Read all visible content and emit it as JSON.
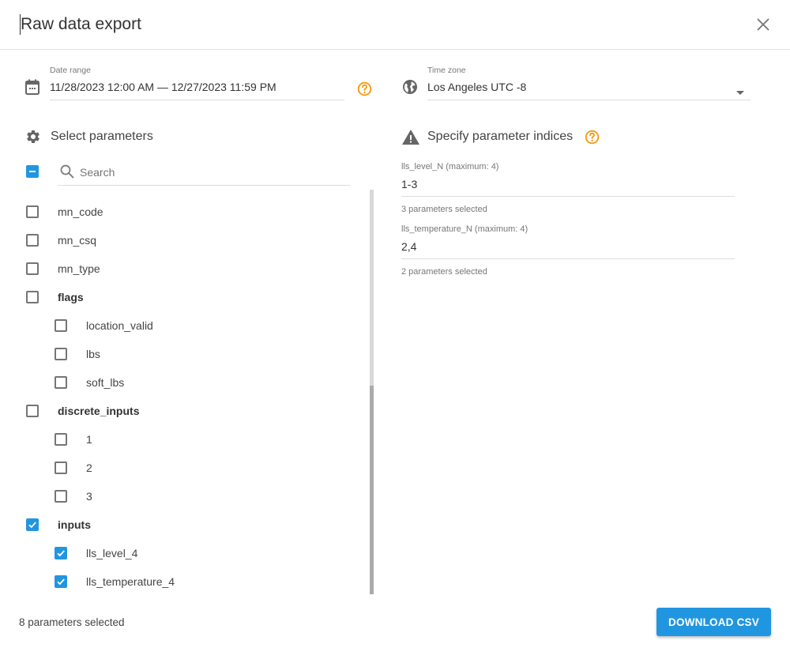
{
  "dialog": {
    "title": "Raw data export",
    "close_icon": "close-icon"
  },
  "date_range": {
    "label": "Date range",
    "value": "11/28/2023 12:00 AM — 12/27/2023 11:59 PM",
    "icon": "calendar-icon",
    "help_icon": "help-circle-icon"
  },
  "time_zone": {
    "label": "Time zone",
    "value": "Los Angeles UTC -8",
    "icon": "globe-icon"
  },
  "select_parameters": {
    "title": "Select parameters",
    "icon": "gear-icon",
    "search_placeholder": "Search",
    "select_all_state": "indeterminate",
    "items": [
      {
        "label": "mn_code",
        "level": 0,
        "group": false,
        "checked": false
      },
      {
        "label": "mn_csq",
        "level": 0,
        "group": false,
        "checked": false
      },
      {
        "label": "mn_type",
        "level": 0,
        "group": false,
        "checked": false
      },
      {
        "label": "flags",
        "level": 0,
        "group": true,
        "checked": false
      },
      {
        "label": "location_valid",
        "level": 1,
        "group": false,
        "checked": false
      },
      {
        "label": "lbs",
        "level": 1,
        "group": false,
        "checked": false
      },
      {
        "label": "soft_lbs",
        "level": 1,
        "group": false,
        "checked": false
      },
      {
        "label": "discrete_inputs",
        "level": 0,
        "group": true,
        "checked": false
      },
      {
        "label": "1",
        "level": 1,
        "group": false,
        "checked": false
      },
      {
        "label": "2",
        "level": 1,
        "group": false,
        "checked": false
      },
      {
        "label": "3",
        "level": 1,
        "group": false,
        "checked": false
      },
      {
        "label": "inputs",
        "level": 0,
        "group": true,
        "checked": true
      },
      {
        "label": "lls_level_4",
        "level": 1,
        "group": false,
        "checked": true
      },
      {
        "label": "lls_temperature_4",
        "level": 1,
        "group": false,
        "checked": true
      }
    ]
  },
  "indices": {
    "title": "Specify parameter indices",
    "icon": "warning-icon",
    "fields": [
      {
        "label": "lls_level_N (maximum: 4)",
        "value": "1-3",
        "hint": "3 parameters selected"
      },
      {
        "label": "lls_temperature_N (maximum: 4)",
        "value": "2,4",
        "hint": "2 parameters selected"
      }
    ]
  },
  "footer": {
    "status": "8 parameters selected",
    "download_label": "DOWNLOAD CSV"
  },
  "colors": {
    "accent": "#2196e0",
    "help": "#f39c12"
  }
}
